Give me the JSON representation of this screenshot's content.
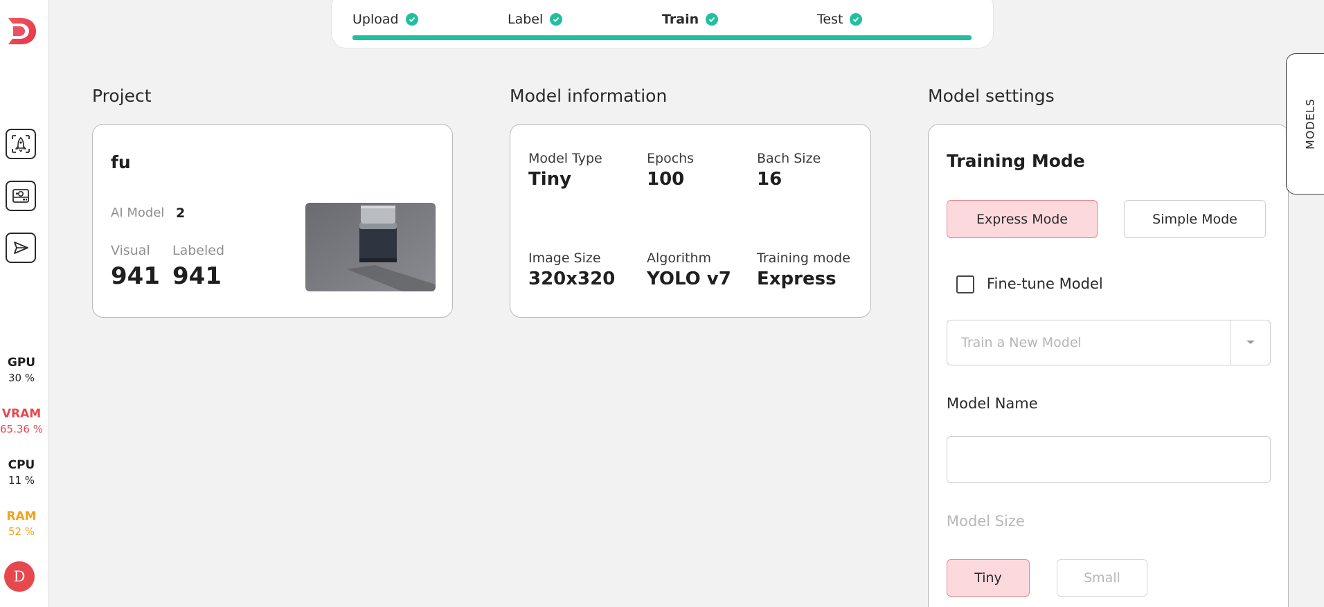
{
  "stepper": {
    "steps": [
      {
        "label": "Upload",
        "done": true
      },
      {
        "label": "Label",
        "done": true
      },
      {
        "label": "Train",
        "done": true,
        "active": true
      },
      {
        "label": "Test",
        "done": true
      }
    ]
  },
  "sidebar": {
    "logo_letter": "D",
    "nav": [
      "rocket-icon",
      "camera-icon",
      "send-icon"
    ],
    "stats": [
      {
        "label": "GPU",
        "value": "30 %",
        "color": "#1f1f1f"
      },
      {
        "label": "VRAM",
        "value": "65.36 %",
        "color": "#e5484d"
      },
      {
        "label": "CPU",
        "value": "11 %",
        "color": "#1f1f1f"
      },
      {
        "label": "RAM",
        "value": "52 %",
        "color": "#f2a21a"
      }
    ],
    "avatar_letter": "D"
  },
  "project": {
    "section_title": "Project",
    "name": "fu",
    "ai_model_label": "AI Model",
    "ai_model_value": "2",
    "visual_label": "Visual",
    "visual_value": "941",
    "labeled_label": "Labeled",
    "labeled_value": "941"
  },
  "model_info": {
    "section_title": "Model information",
    "items": [
      {
        "label": "Model Type",
        "value": "Tiny"
      },
      {
        "label": "Epochs",
        "value": "100"
      },
      {
        "label": "Bach Size",
        "value": "16"
      },
      {
        "label": "Image Size",
        "value": "320x320"
      },
      {
        "label": "Algorithm",
        "value": "YOLO v7"
      },
      {
        "label": "Training mode",
        "value": "Express"
      }
    ]
  },
  "settings": {
    "section_title": "Model settings",
    "training_mode_title": "Training Mode",
    "express_label": "Express Mode",
    "simple_label": "Simple Mode",
    "finetune_label": "Fine-tune Model",
    "finetune_checked": false,
    "select_placeholder": "Train a New Model",
    "model_name_label": "Model Name",
    "model_name_value": "",
    "model_size_label": "Model Size",
    "size_tiny": "Tiny",
    "size_small": "Small"
  },
  "models_tab_label": "MODELS",
  "colors": {
    "accent": "#20bfa0",
    "brand": "#e5484d",
    "selected_bg": "#fcd9dc"
  }
}
